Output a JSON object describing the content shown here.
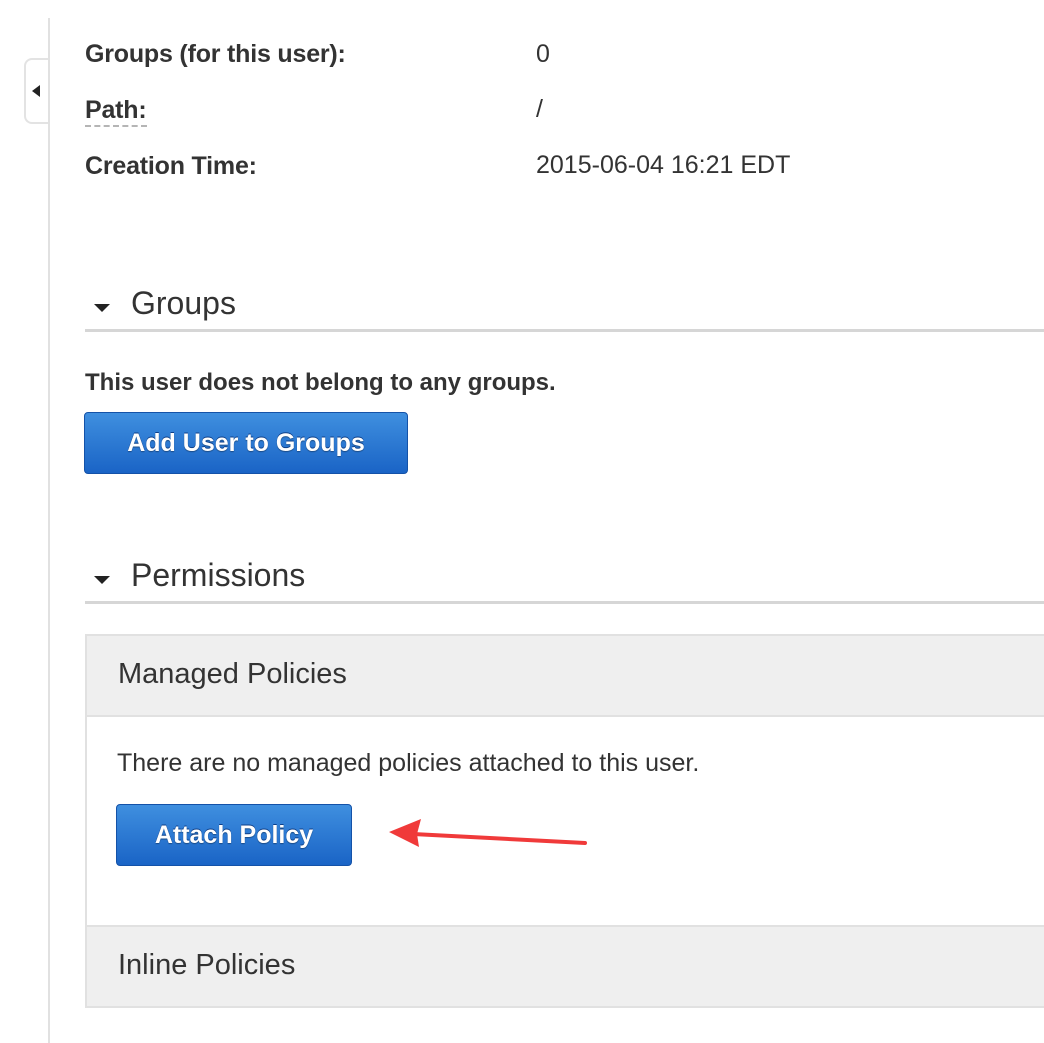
{
  "summary": {
    "groups_label": "Groups (for this user):",
    "groups_value": "0",
    "path_label": "Path:",
    "path_value": "/",
    "creation_label": "Creation Time:",
    "creation_value": "2015-06-04 16:21 EDT"
  },
  "groups_section": {
    "title": "Groups",
    "message": "This user does not belong to any groups.",
    "add_button_label": "Add User to Groups"
  },
  "permissions_section": {
    "title": "Permissions",
    "managed_policies_title": "Managed Policies",
    "managed_policies_message": "There are no managed policies attached to this user.",
    "attach_button_label": "Attach Policy",
    "inline_policies_title": "Inline Policies"
  },
  "icons": {
    "collapse": "collapse-left-icon",
    "section_caret": "caret-down-icon",
    "annotation_arrow": "red-arrow-annotation"
  },
  "colors": {
    "button_blue": "#1f6fd0",
    "annotation_red": "#f03a3a",
    "panel_bg": "#efefef"
  }
}
